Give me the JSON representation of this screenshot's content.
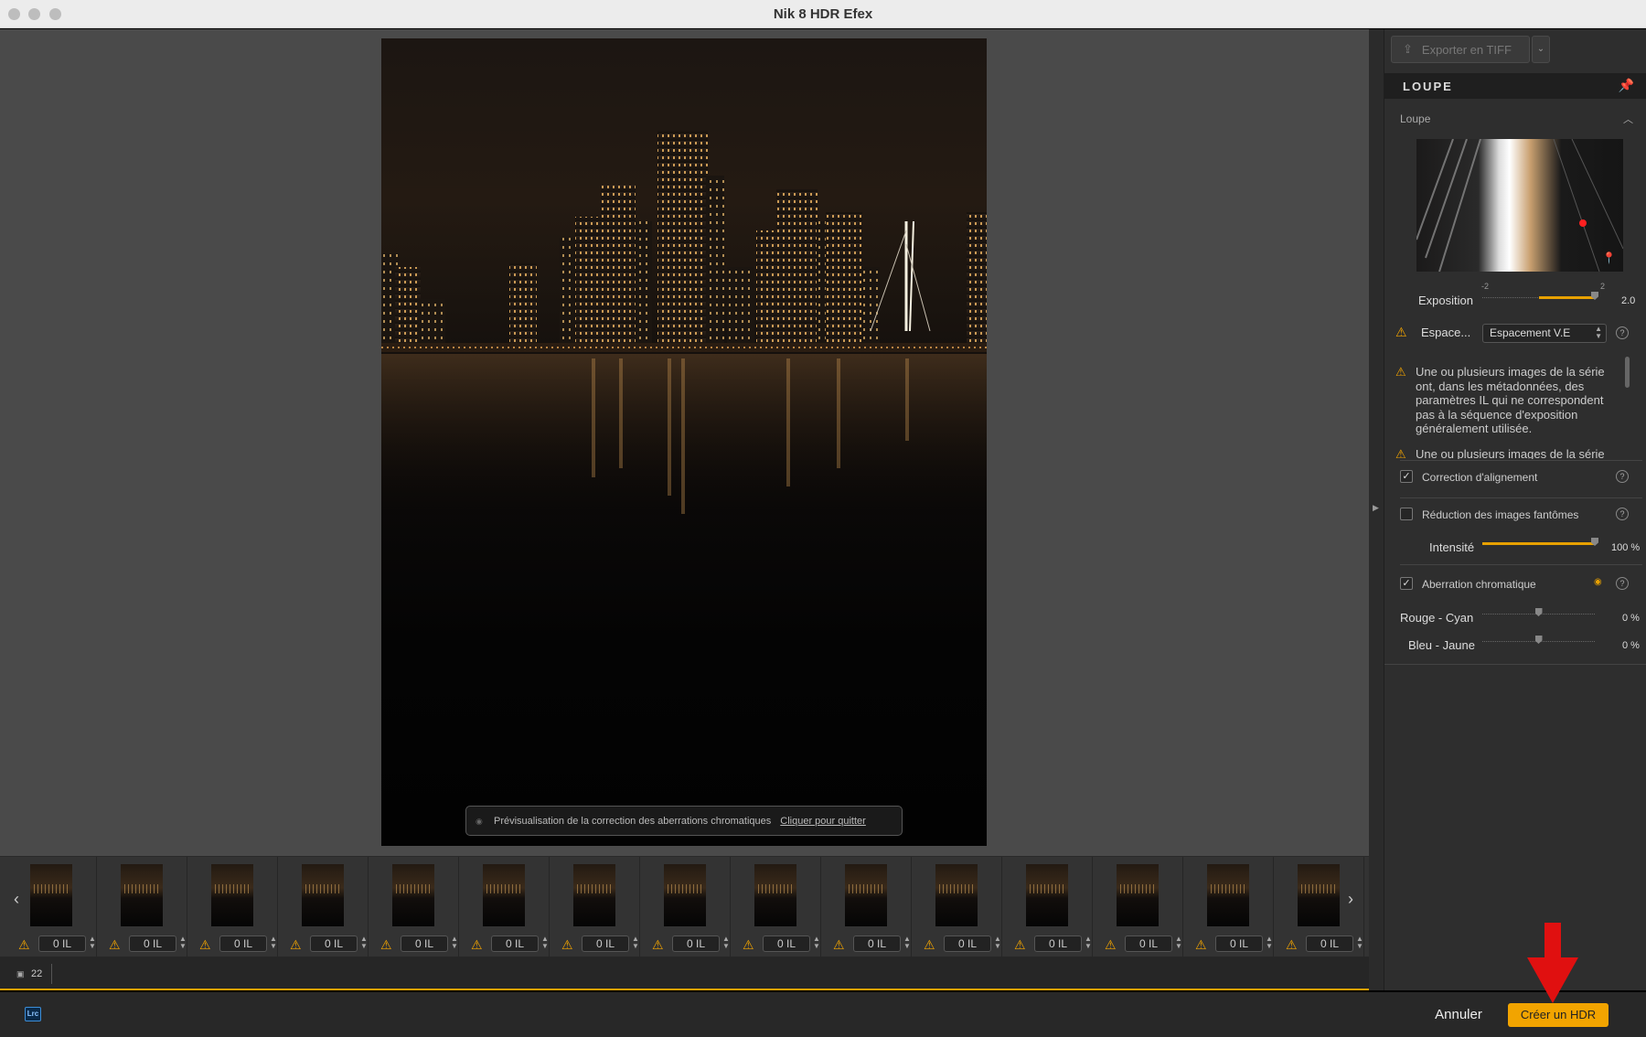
{
  "window": {
    "title": "Nik 8 HDR Efex"
  },
  "preview": {
    "ca_banner_text": "Prévisualisation de la correction des aberrations chromatiques",
    "ca_banner_quit": "Cliquer pour quitter"
  },
  "filmstrip": {
    "frames": [
      {
        "ev": "0 IL"
      },
      {
        "ev": "0 IL"
      },
      {
        "ev": "0 IL"
      },
      {
        "ev": "0 IL"
      },
      {
        "ev": "0 IL"
      },
      {
        "ev": "0 IL"
      },
      {
        "ev": "0 IL"
      },
      {
        "ev": "0 IL"
      },
      {
        "ev": "0 IL"
      },
      {
        "ev": "0 IL"
      },
      {
        "ev": "0 IL"
      },
      {
        "ev": "0 IL"
      },
      {
        "ev": "0 IL"
      },
      {
        "ev": "0 IL"
      },
      {
        "ev": "0 IL"
      }
    ],
    "image_count": "22"
  },
  "panel": {
    "export_label": "Exporter en TIFF",
    "section_title": "LOUPE",
    "loupe_sub": "Loupe",
    "exposure": {
      "label": "Exposition",
      "value": "2.0",
      "min_label": "-2",
      "max_label": "2",
      "fraction": 1.0
    },
    "spacing": {
      "label": "Espace...",
      "selected": "Espacement V.E"
    },
    "warnings": [
      "Une ou plusieurs images de la série ont, dans les métadonnées, des paramètres IL qui ne correspondent pas à la séquence d'exposition généralement utilisée.",
      "Une ou plusieurs images de la série"
    ],
    "alignment": {
      "label": "Correction d'alignement",
      "checked": true
    },
    "ghost": {
      "label": "Réduction des images fantômes",
      "checked": false
    },
    "intensity": {
      "label": "Intensité",
      "value": "100 %",
      "fraction": 1.0
    },
    "chromatic": {
      "label": "Aberration chromatique",
      "checked": true
    },
    "red_cyan": {
      "label": "Rouge - Cyan",
      "value": "0 %",
      "fraction": 0.5
    },
    "blue_yellow": {
      "label": "Bleu - Jaune",
      "value": "0 %",
      "fraction": 0.5
    }
  },
  "bottom": {
    "lrc_label": "Lrc",
    "cancel_label": "Annuler",
    "create_label": "Créer un HDR"
  },
  "colors": {
    "accent": "#f2a400",
    "arrow": "#e01010"
  }
}
